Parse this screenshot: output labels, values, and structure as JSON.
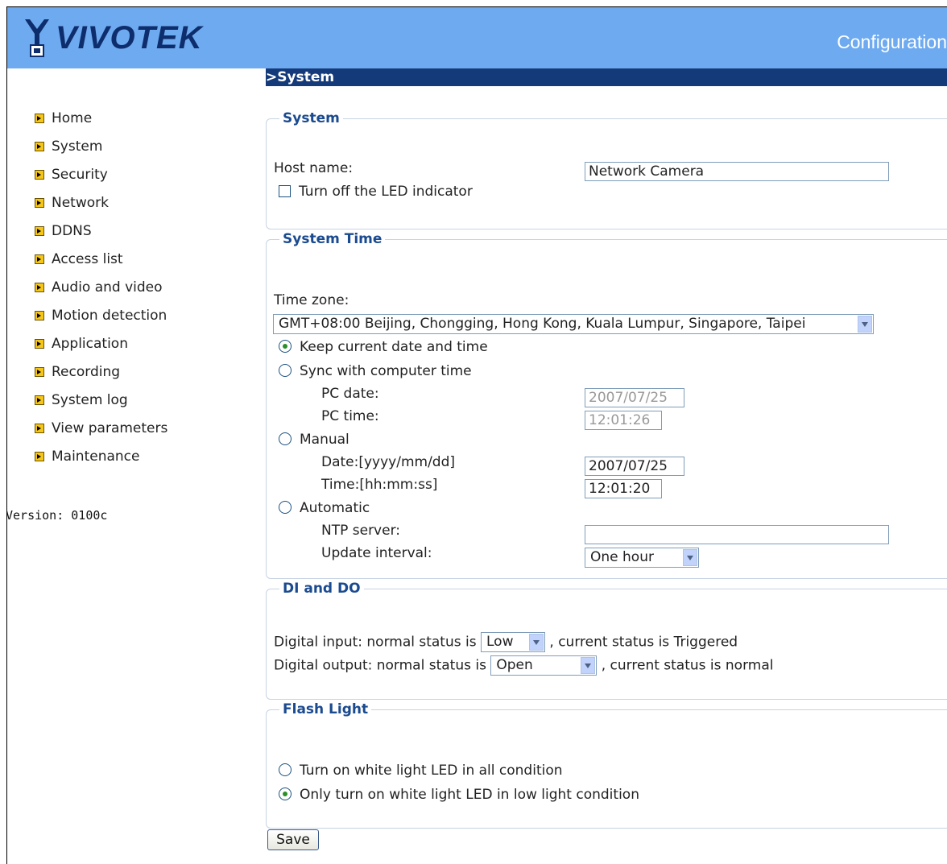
{
  "header": {
    "brand": "VIVOTEK",
    "title": "Configuration"
  },
  "sidebar": {
    "items": [
      {
        "label": "Home"
      },
      {
        "label": "System"
      },
      {
        "label": "Security"
      },
      {
        "label": "Network"
      },
      {
        "label": "DDNS"
      },
      {
        "label": "Access list"
      },
      {
        "label": "Audio and video"
      },
      {
        "label": "Motion detection"
      },
      {
        "label": "Application"
      },
      {
        "label": "Recording"
      },
      {
        "label": "System log"
      },
      {
        "label": "View parameters"
      },
      {
        "label": "Maintenance"
      }
    ],
    "version": "Version: 0100c"
  },
  "page": {
    "section_title": ">System"
  },
  "system": {
    "legend": "System",
    "host_label": "Host name:",
    "host_value": "Network Camera",
    "led_label": "Turn off the LED indicator",
    "led_checked": false
  },
  "time": {
    "legend": "System Time",
    "zone_label": "Time zone:",
    "zone_value": "GMT+08:00 Beijing, Chongging, Hong Kong, Kuala Lumpur, Singapore, Taipei",
    "keep_label": "Keep current date and time",
    "sync_label": "Sync with computer time",
    "pc_date_label": "PC date:",
    "pc_date_value": "2007/07/25",
    "pc_time_label": "PC time:",
    "pc_time_value": "12:01:26",
    "manual_label": "Manual",
    "date_label": "Date:[yyyy/mm/dd]",
    "date_value": "2007/07/25",
    "time_label": "Time:[hh:mm:ss]",
    "time_value": "12:01:20",
    "auto_label": "Automatic",
    "ntp_label": "NTP server:",
    "ntp_value": "",
    "interval_label": "Update interval:",
    "interval_value": "One hour",
    "selected": "keep"
  },
  "dido": {
    "legend": "DI and DO",
    "di_prefix": "Digital input: normal status is",
    "di_value": "Low",
    "di_suffix": ", current status is Triggered",
    "do_prefix": "Digital output: normal status is",
    "do_value": "Open",
    "do_suffix": ", current status is normal"
  },
  "flash": {
    "legend": "Flash Light",
    "opt_all": "Turn on white light LED in all condition",
    "opt_low": "Only turn on white light LED in low light condition",
    "selected": "low"
  },
  "actions": {
    "save": "Save"
  },
  "colors": {
    "header": "#6eaaf0",
    "section_bar": "#143a7a",
    "legend": "#1a4a8f",
    "brand": "#0d2d6c"
  }
}
